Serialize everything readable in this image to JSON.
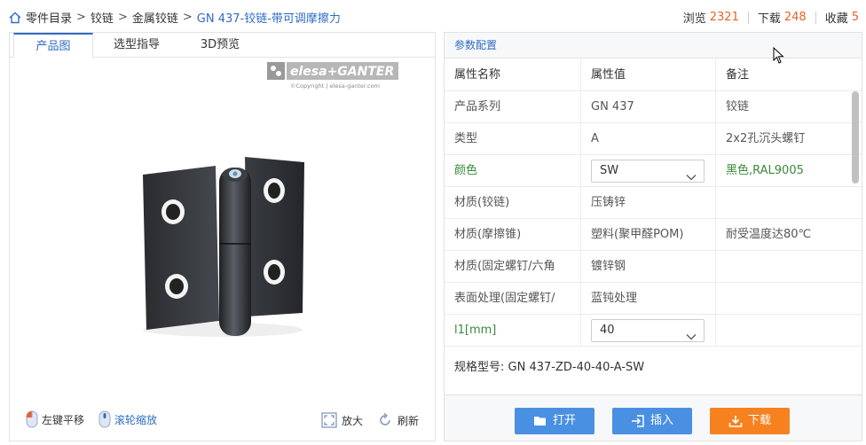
{
  "breadcrumb": {
    "items": [
      "零件目录",
      "铰链",
      "金属铰链"
    ],
    "current": "GN 437-铰链-带可调摩擦力"
  },
  "stats": {
    "views_label": "浏览",
    "views": "2321",
    "downloads_label": "下载",
    "downloads": "248",
    "favorites_label": "收藏",
    "favorites": "5"
  },
  "tabs": [
    "产品图",
    "选型指导",
    "3D预览"
  ],
  "brand": {
    "name": "elesa+GANTER",
    "copyright": "©Copyright | elesa-ganter.com"
  },
  "viewer_tools": {
    "pan": "左键平移",
    "zoom_wheel": "滚轮缩放",
    "enlarge": "放大",
    "refresh": "刷新"
  },
  "params": {
    "title": "参数配置",
    "headers": [
      "属性名称",
      "属性值",
      "备注"
    ],
    "rows": [
      {
        "name": "产品系列",
        "value": "GN 437",
        "note": "铰链"
      },
      {
        "name": "类型",
        "value": "A",
        "note": "2x2孔沉头螺钉"
      },
      {
        "name": "颜色",
        "value": "SW",
        "note": "黑色,RAL9005",
        "select": true
      },
      {
        "name": "材质(铰链)",
        "value": "压铸锌",
        "note": ""
      },
      {
        "name": "材质(摩擦锥)",
        "value": "塑料(聚甲醛POM)",
        "note": "耐受温度达80℃"
      },
      {
        "name": "材质(固定螺钉/六角",
        "value": "镀锌钢",
        "note": ""
      },
      {
        "name": "表面处理(固定螺钉/",
        "value": "蓝钝处理",
        "note": ""
      },
      {
        "name": "l1[mm]",
        "value": "40",
        "note": "",
        "select": true
      }
    ],
    "spec_label": "规格型号:",
    "spec_value": "GN 437-ZD-40-40-A-SW"
  },
  "actions": {
    "open": "打开",
    "insert": "插入",
    "download": "下载"
  },
  "colors": {
    "accent": "#2e6bc4",
    "orange": "#f5821f",
    "button_blue": "#4a90e2",
    "green": "#3a8a3a",
    "stat_num": "#e8612c"
  }
}
